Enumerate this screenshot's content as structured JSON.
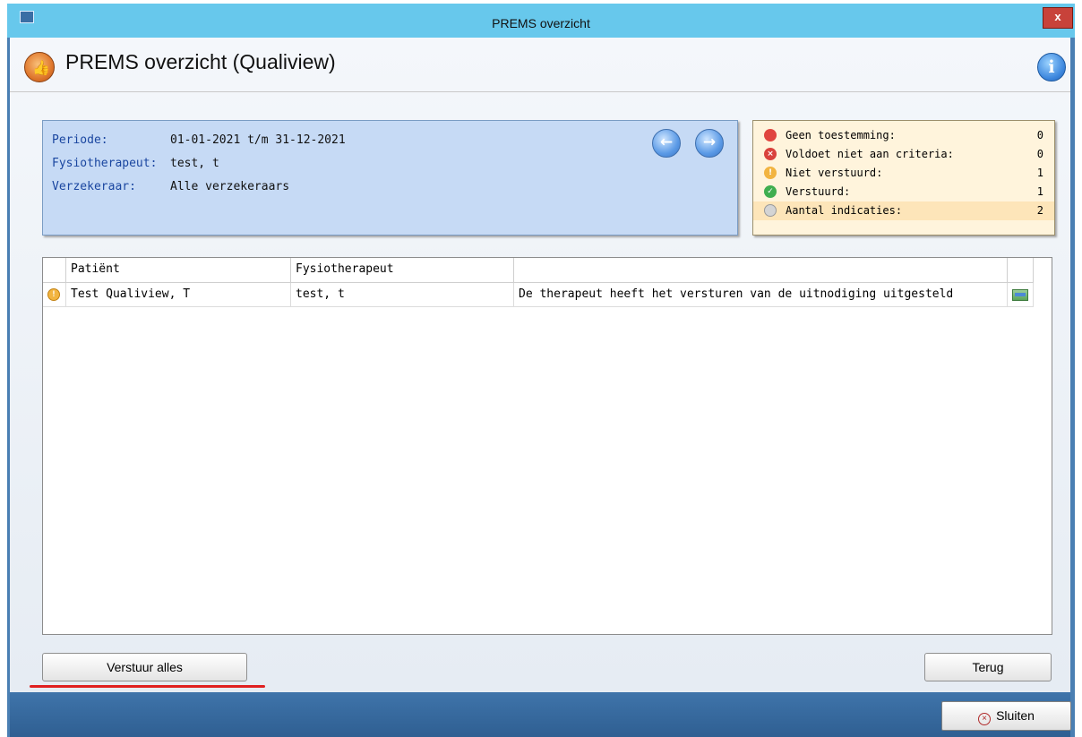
{
  "window": {
    "title": "PREMS overzicht",
    "close_label": "x"
  },
  "header": {
    "title": "PREMS overzicht (Qualiview)",
    "info_icon": "i"
  },
  "filters": {
    "periode_label": "Periode:",
    "periode_value": "01-01-2021 t/m 31-12-2021",
    "fysio_label": "Fysiotherapeut:",
    "fysio_value": "test, t",
    "verzekeraar_label": "Verzekeraar:",
    "verzekeraar_value": "Alle verzekeraars"
  },
  "status": {
    "items": [
      {
        "label": "Geen toestemming:",
        "count": "0",
        "icon": "red-circle-icon",
        "color": "#e0453f"
      },
      {
        "label": "Voldoet niet aan criteria:",
        "count": "0",
        "icon": "red-x-icon",
        "color": "#d9423c"
      },
      {
        "label": "Niet verstuurd:",
        "count": "1",
        "icon": "warning-icon",
        "color": "#f2b440"
      },
      {
        "label": "Verstuurd:",
        "count": "1",
        "icon": "check-icon",
        "color": "#3fae4f"
      },
      {
        "label": "Aantal indicaties:",
        "count": "2",
        "icon": "gray-circle-icon",
        "color": "#c8c8c8"
      }
    ]
  },
  "table": {
    "headers": [
      "",
      "Patiënt",
      "Fysiotherapeut",
      "",
      ""
    ],
    "rows": [
      {
        "status_icon": "warning-icon",
        "patient": "Test Qualiview, T",
        "fysiotherapeut": "test, t",
        "message": "De therapeut heeft het versturen van de uitnodiging uitgesteld",
        "action_icon": "send-icon"
      }
    ]
  },
  "buttons": {
    "verstuur_alles": "Verstuur alles",
    "terug": "Terug",
    "sluiten": "Sluiten"
  },
  "colors": {
    "titlebar": "#67c8ec",
    "period_panel": "#c6daf5",
    "status_panel": "#fff4dc",
    "highlight_line": "#e02020"
  }
}
